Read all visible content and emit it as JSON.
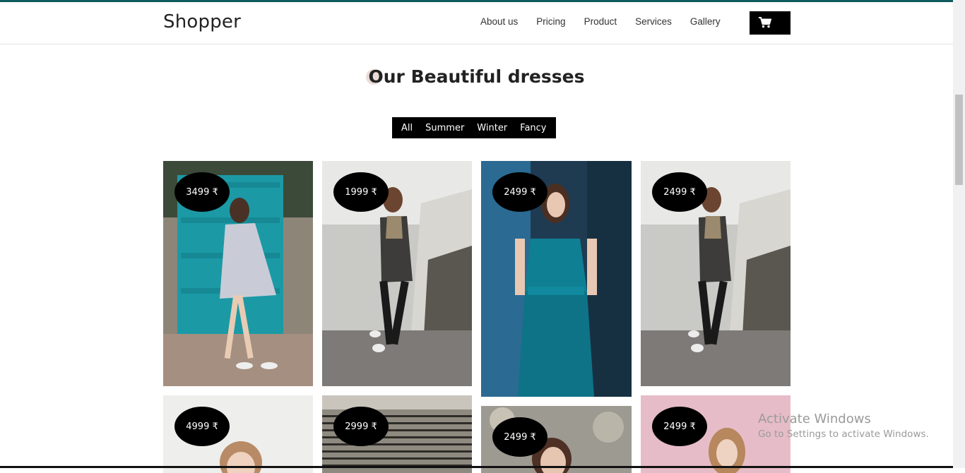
{
  "brand": "Shopper",
  "nav": {
    "links": [
      "About us",
      "Pricing",
      "Product",
      "Services",
      "Gallery"
    ],
    "cart_icon": "shopping-cart-icon"
  },
  "section": {
    "title": "Our Beautiful dresses"
  },
  "filters": [
    "All",
    "Summer",
    "Winter",
    "Fancy"
  ],
  "products": [
    {
      "price": "3499 ₹",
      "description": "woman in striped off-shoulder dress by teal door"
    },
    {
      "price": "1999 ₹",
      "description": "woman in grey cardigan and scarf leaning on wall"
    },
    {
      "price": "2499 ₹",
      "description": "woman in teal halter jumpsuit"
    },
    {
      "price": "2499 ₹",
      "description": "woman in grey cardigan and scarf leaning on wall"
    },
    {
      "price": "4999 ₹",
      "description": "woman portrait"
    },
    {
      "price": "2999 ₹",
      "description": "woman portrait by building"
    },
    {
      "price": "2499 ₹",
      "description": "woman portrait outdoors"
    },
    {
      "price": "2499 ₹",
      "description": "woman with curly hair on pink background"
    }
  ],
  "watermark": {
    "title": "Activate Windows",
    "subtitle": "Go to Settings to activate Windows."
  },
  "colors": {
    "accent_strip": "#0f5a5a",
    "badge": "#000000",
    "filter_bar": "#000000",
    "title_circle": "#eadbd6"
  }
}
